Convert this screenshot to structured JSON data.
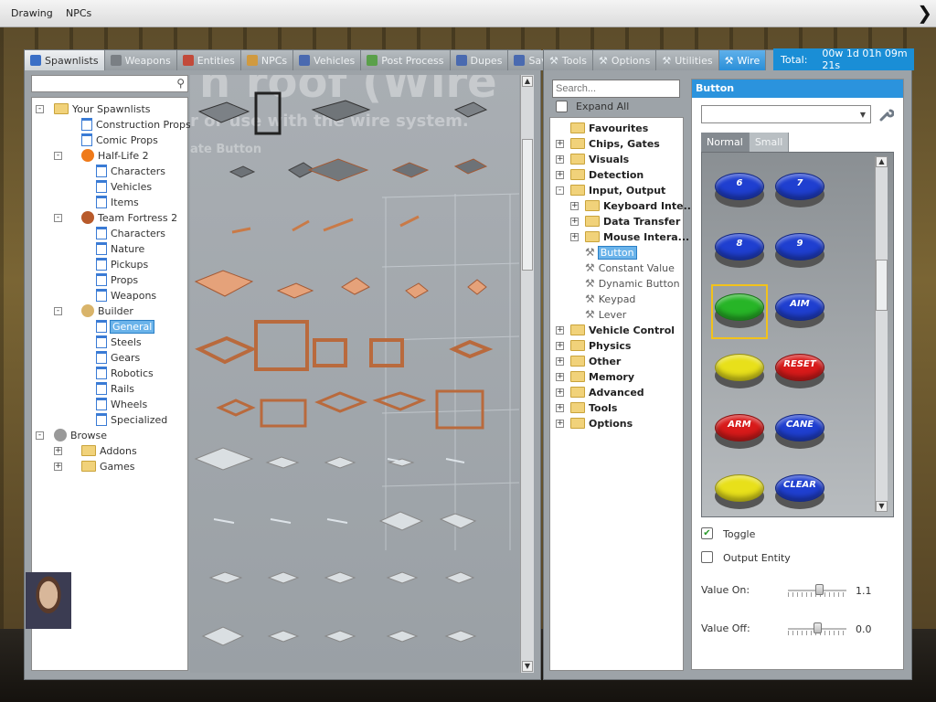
{
  "menubar": {
    "items": [
      "Drawing",
      "NPCs"
    ],
    "arrow": "❯"
  },
  "spawn_tabs": [
    {
      "label": "Spawnlists",
      "icon": "grid-icon",
      "color": "#3a6fc6",
      "active": true
    },
    {
      "label": "Weapons",
      "icon": "gun-icon",
      "color": "#7a7f84"
    },
    {
      "label": "Entities",
      "icon": "entities-icon",
      "color": "#c24a3a"
    },
    {
      "label": "NPCs",
      "icon": "npc-face-icon",
      "color": "#d09a40"
    },
    {
      "label": "Vehicles",
      "icon": "car-icon",
      "color": "#4a6ab0"
    },
    {
      "label": "Post Process",
      "icon": "picture-icon",
      "color": "#5aa04a"
    },
    {
      "label": "Dupes",
      "icon": "dupes-icon",
      "color": "#4a6ab0"
    },
    {
      "label": "Saves",
      "icon": "save-icon",
      "color": "#4a6ab0"
    }
  ],
  "spawn_tree": [
    {
      "label": "Your Spawnlists",
      "level": 0,
      "icon": "folder",
      "exp": "-"
    },
    {
      "label": "Construction Props",
      "level": 1,
      "icon": "file"
    },
    {
      "label": "Comic Props",
      "level": 1,
      "icon": "file"
    },
    {
      "label": "Half-Life 2",
      "level": 1,
      "icon": "hl2",
      "exp": "-"
    },
    {
      "label": "Characters",
      "level": 2,
      "icon": "file"
    },
    {
      "label": "Vehicles",
      "level": 2,
      "icon": "file"
    },
    {
      "label": "Items",
      "level": 2,
      "icon": "file"
    },
    {
      "label": "Team Fortress 2",
      "level": 1,
      "icon": "tf2",
      "exp": "-"
    },
    {
      "label": "Characters",
      "level": 2,
      "icon": "file"
    },
    {
      "label": "Nature",
      "level": 2,
      "icon": "file"
    },
    {
      "label": "Pickups",
      "level": 2,
      "icon": "file"
    },
    {
      "label": "Props",
      "level": 2,
      "icon": "file"
    },
    {
      "label": "Weapons",
      "level": 2,
      "icon": "file"
    },
    {
      "label": "Builder",
      "level": 1,
      "icon": "wrench",
      "exp": "-"
    },
    {
      "label": "General",
      "level": 2,
      "icon": "file",
      "selected": true
    },
    {
      "label": "Steels",
      "level": 2,
      "icon": "file"
    },
    {
      "label": "Gears",
      "level": 2,
      "icon": "file"
    },
    {
      "label": "Robotics",
      "level": 2,
      "icon": "file"
    },
    {
      "label": "Rails",
      "level": 2,
      "icon": "file"
    },
    {
      "label": "Wheels",
      "level": 2,
      "icon": "file"
    },
    {
      "label": "Specialized",
      "level": 2,
      "icon": "file"
    },
    {
      "label": "Browse",
      "level": 0,
      "icon": "gear",
      "exp": "-"
    },
    {
      "label": "Addons",
      "level": 1,
      "icon": "folder",
      "exp": "+"
    },
    {
      "label": "Games",
      "level": 1,
      "icon": "folder",
      "exp": "+"
    }
  ],
  "background_text": {
    "line1": "n roof (Wire",
    "line2": "r or use with the wire system.",
    "line3": "ate Button"
  },
  "ctx_tabs": [
    {
      "label": "Tools",
      "icon": "wrench-icon"
    },
    {
      "label": "Options",
      "icon": "wrench-icon"
    },
    {
      "label": "Utilities",
      "icon": "wrench-icon"
    },
    {
      "label": "Wire",
      "icon": "wrench-icon",
      "active": true
    }
  ],
  "total": {
    "label": "Total:",
    "value": "00w 1d 01h 09m 21s"
  },
  "wire_search": {
    "placeholder": "Search..."
  },
  "expand_all": {
    "label": "Expand All",
    "checked": false
  },
  "wire_tree": [
    {
      "label": "Favourites",
      "level": 0,
      "kind": "folder"
    },
    {
      "label": "Chips, Gates",
      "level": 0,
      "kind": "folder",
      "exp": "+"
    },
    {
      "label": "Visuals",
      "level": 0,
      "kind": "folder",
      "exp": "+"
    },
    {
      "label": "Detection",
      "level": 0,
      "kind": "folder",
      "exp": "+"
    },
    {
      "label": "Input, Output",
      "level": 0,
      "kind": "folder",
      "exp": "-"
    },
    {
      "label": "Keyboard Inte...",
      "level": 1,
      "kind": "folder",
      "exp": "+"
    },
    {
      "label": "Data Transfer",
      "level": 1,
      "kind": "folder",
      "exp": "+"
    },
    {
      "label": "Mouse Intera...",
      "level": 1,
      "kind": "folder",
      "exp": "+"
    },
    {
      "label": "Button",
      "level": 1,
      "kind": "tool",
      "selected": true
    },
    {
      "label": "Constant Value",
      "level": 1,
      "kind": "tool"
    },
    {
      "label": "Dynamic Button",
      "level": 1,
      "kind": "tool"
    },
    {
      "label": "Keypad",
      "level": 1,
      "kind": "tool"
    },
    {
      "label": "Lever",
      "level": 1,
      "kind": "tool"
    },
    {
      "label": "Vehicle Control",
      "level": 0,
      "kind": "folder",
      "exp": "+"
    },
    {
      "label": "Physics",
      "level": 0,
      "kind": "folder",
      "exp": "+"
    },
    {
      "label": "Other",
      "level": 0,
      "kind": "folder",
      "exp": "+"
    },
    {
      "label": "Memory",
      "level": 0,
      "kind": "folder",
      "exp": "+"
    },
    {
      "label": "Advanced",
      "level": 0,
      "kind": "folder",
      "exp": "+"
    },
    {
      "label": "Tools",
      "level": 0,
      "kind": "folder",
      "exp": "+"
    },
    {
      "label": "Options",
      "level": 0,
      "kind": "folder",
      "exp": "+"
    }
  ],
  "props_panel": {
    "title": "Button",
    "preset_value": "",
    "subtabs": [
      {
        "label": "Normal",
        "active": true
      },
      {
        "label": "Small"
      }
    ],
    "buttons": [
      {
        "text": "6",
        "color": "#1f3fd0"
      },
      {
        "text": "7",
        "color": "#1f3fd0"
      },
      {
        "text": "8",
        "color": "#1f3fd0"
      },
      {
        "text": "9",
        "color": "#1f3fd0"
      },
      {
        "text": "",
        "color": "#27b527",
        "selected": true
      },
      {
        "text": "AIM",
        "color": "#1f3fd0"
      },
      {
        "text": "",
        "color": "#e8e01a"
      },
      {
        "text": "RESET",
        "color": "#d81a1a"
      },
      {
        "text": "ARM",
        "color": "#d81a1a"
      },
      {
        "text": "CANE",
        "color": "#1f3fd0"
      },
      {
        "text": "",
        "color": "#e8e01a"
      },
      {
        "text": "CLEAR",
        "color": "#1f3fd0"
      }
    ],
    "toggle": {
      "label": "Toggle",
      "checked": true
    },
    "output_entity": {
      "label": "Output Entity",
      "checked": false
    },
    "value_on": {
      "label": "Value On:",
      "value": "1.1",
      "level": 0.55
    },
    "value_off": {
      "label": "Value Off:",
      "value": "0.0",
      "level": 0.5
    }
  }
}
